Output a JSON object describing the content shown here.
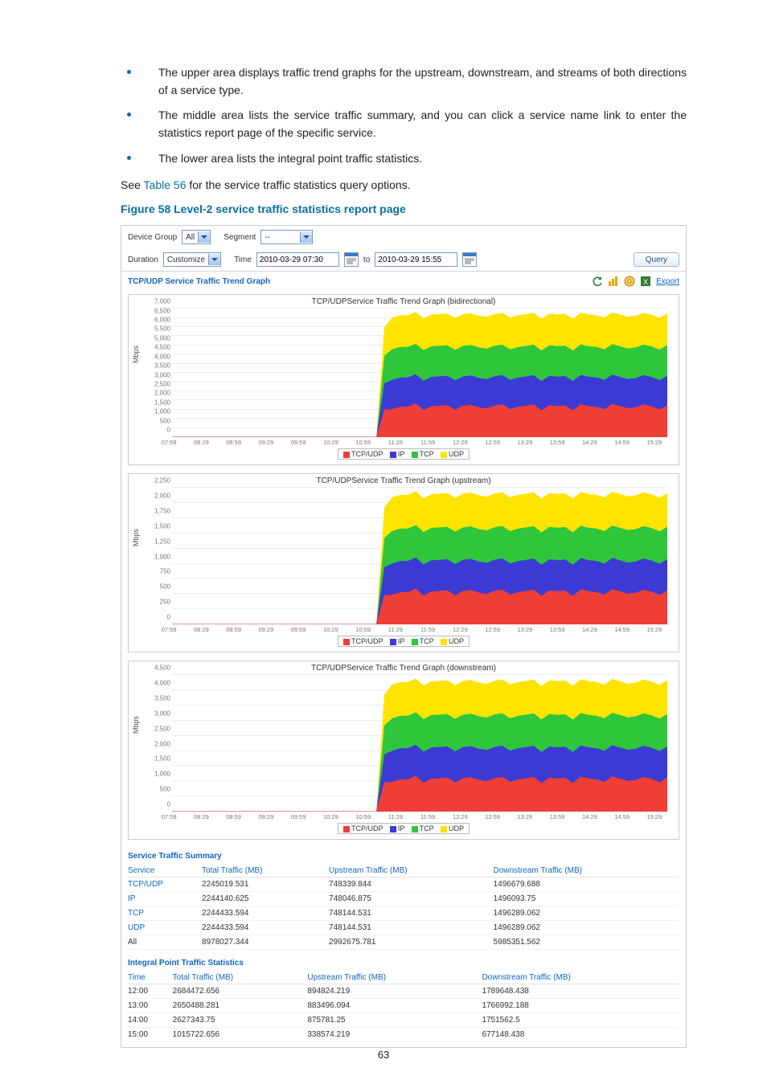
{
  "bullets": [
    "The upper area displays traffic trend graphs for the upstream, downstream, and streams of both directions of a service type.",
    "The middle area lists the service traffic summary, and you can click a service name link to enter the statistics report page of the specific service.",
    "The lower area lists the integral point traffic statistics."
  ],
  "see_before": "See ",
  "see_link": "Table 56",
  "see_after": " for the service traffic statistics query options.",
  "figure_caption": "Figure 58 Level-2 service traffic statistics report page",
  "page_number": "63",
  "form": {
    "device_group_label": "Device Group",
    "device_group_value": "All",
    "segment_label": "Segment",
    "segment_value": "--",
    "duration_label": "Duration",
    "duration_value": "Customize",
    "time_label": "Time",
    "start_value": "2010-03-29 07:30",
    "to_label": "to",
    "end_value": "2010-03-29 15:55",
    "query_label": "Query"
  },
  "panel_title": "TCP/UDP Service Traffic Trend Graph",
  "export_label": "Export",
  "chart_titles": {
    "bi": "TCP/UDPService Traffic Trend Graph (bidirectional)",
    "up": "TCP/UDPService Traffic Trend Graph (upstream)",
    "down": "TCP/UDPService Traffic Trend Graph (downstream)"
  },
  "xticks": [
    "07:59",
    "08:29",
    "08:59",
    "09:29",
    "09:59",
    "10:29",
    "10:59",
    "11:29",
    "11:59",
    "12:29",
    "12:59",
    "13:29",
    "13:59",
    "14:29",
    "14:59",
    "15:29"
  ],
  "yticks": {
    "bi": [
      "0",
      "500",
      "1,000",
      "1,500",
      "2,000",
      "2,500",
      "3,000",
      "3,500",
      "4,000",
      "4,500",
      "5,000",
      "5,500",
      "6,000",
      "6,500",
      "7,000"
    ],
    "up": [
      "0",
      "250",
      "500",
      "750",
      "1,000",
      "1,250",
      "1,500",
      "1,750",
      "2,000",
      "2,250"
    ],
    "down": [
      "0",
      "500",
      "1,000",
      "1,500",
      "2,000",
      "2,500",
      "3,000",
      "3,500",
      "4,000",
      "4,500"
    ]
  },
  "legend": [
    "TCP/UDP",
    "IP",
    "TCP",
    "UDP"
  ],
  "ylabel": "Mbps",
  "chart_data": [
    {
      "type": "area",
      "title": "TCP/UDPService Traffic Trend Graph (bidirectional)",
      "xlabel": "",
      "ylabel": "Mbps",
      "ylim": [
        0,
        7000
      ],
      "x": [
        "07:59",
        "08:29",
        "08:59",
        "09:29",
        "09:59",
        "10:29",
        "10:59",
        "11:29",
        "11:59",
        "12:29",
        "12:59",
        "13:29",
        "13:59",
        "14:29",
        "14:59",
        "15:29"
      ],
      "series": [
        {
          "name": "TCP/UDP",
          "values": [
            0,
            0,
            0,
            0,
            0,
            0,
            0,
            1600,
            1650,
            1500,
            1550,
            1700,
            1500,
            1550,
            1650,
            1500
          ]
        },
        {
          "name": "IP",
          "values": [
            0,
            0,
            0,
            0,
            0,
            0,
            0,
            1600,
            1650,
            1500,
            1550,
            1700,
            1500,
            1550,
            1650,
            1500
          ]
        },
        {
          "name": "TCP",
          "values": [
            0,
            0,
            0,
            0,
            0,
            0,
            0,
            1600,
            1650,
            1500,
            1550,
            1700,
            1500,
            1550,
            1650,
            1500
          ]
        },
        {
          "name": "UDP",
          "values": [
            0,
            0,
            0,
            0,
            0,
            0,
            0,
            1600,
            1650,
            1500,
            1550,
            1700,
            1500,
            1550,
            1650,
            1500
          ]
        }
      ],
      "note": "Series values are per-layer contributions; total (stacked) peaks around 6500–6800 Mbps during 11:29–15:29 and is ~0 before ~11:00."
    },
    {
      "type": "area",
      "title": "TCP/UDPService Traffic Trend Graph (upstream)",
      "xlabel": "",
      "ylabel": "Mbps",
      "ylim": [
        0,
        2250
      ],
      "x": [
        "07:59",
        "08:29",
        "08:59",
        "09:29",
        "09:59",
        "10:29",
        "10:59",
        "11:29",
        "11:59",
        "12:29",
        "12:59",
        "13:29",
        "13:59",
        "14:29",
        "14:59",
        "15:29"
      ],
      "series": [
        {
          "name": "TCP/UDP",
          "values": [
            0,
            0,
            0,
            0,
            0,
            0,
            0,
            530,
            550,
            500,
            520,
            560,
            500,
            520,
            550,
            500
          ]
        },
        {
          "name": "IP",
          "values": [
            0,
            0,
            0,
            0,
            0,
            0,
            0,
            530,
            550,
            500,
            520,
            560,
            500,
            520,
            550,
            500
          ]
        },
        {
          "name": "TCP",
          "values": [
            0,
            0,
            0,
            0,
            0,
            0,
            0,
            530,
            550,
            500,
            520,
            560,
            500,
            520,
            550,
            500
          ]
        },
        {
          "name": "UDP",
          "values": [
            0,
            0,
            0,
            0,
            0,
            0,
            0,
            530,
            550,
            500,
            520,
            560,
            500,
            520,
            550,
            500
          ]
        }
      ],
      "note": "Stacked total peaks around 2100–2200 Mbps during 11:29–15:29."
    },
    {
      "type": "area",
      "title": "TCP/UDPService Traffic Trend Graph (downstream)",
      "xlabel": "",
      "ylabel": "Mbps",
      "ylim": [
        0,
        4500
      ],
      "x": [
        "07:59",
        "08:29",
        "08:59",
        "09:29",
        "09:59",
        "10:29",
        "10:59",
        "11:29",
        "11:59",
        "12:29",
        "12:59",
        "13:29",
        "13:59",
        "14:29",
        "14:59",
        "15:29"
      ],
      "series": [
        {
          "name": "TCP/UDP",
          "values": [
            0,
            0,
            0,
            0,
            0,
            0,
            0,
            1070,
            1100,
            1000,
            1030,
            1140,
            1000,
            1030,
            1100,
            1000
          ]
        },
        {
          "name": "IP",
          "values": [
            0,
            0,
            0,
            0,
            0,
            0,
            0,
            1070,
            1100,
            1000,
            1030,
            1140,
            1000,
            1030,
            1100,
            1000
          ]
        },
        {
          "name": "TCP",
          "values": [
            0,
            0,
            0,
            0,
            0,
            0,
            0,
            1070,
            1100,
            1000,
            1030,
            1140,
            1000,
            1030,
            1100,
            1000
          ]
        },
        {
          "name": "UDP",
          "values": [
            0,
            0,
            0,
            0,
            0,
            0,
            0,
            1070,
            1100,
            1000,
            1030,
            1140,
            1000,
            1030,
            1100,
            1000
          ]
        }
      ],
      "note": "Stacked total peaks around 4300–4500 Mbps during 11:29–15:29."
    }
  ],
  "summary": {
    "title": "Service Traffic Summary",
    "cols": [
      "Service",
      "Total Traffic (MB)",
      "Upstream Traffic (MB)",
      "Downstream Traffic (MB)"
    ],
    "rows": [
      [
        "TCP/UDP",
        "2245019.531",
        "748339.844",
        "1496679.688"
      ],
      [
        "IP",
        "2244140.625",
        "748046.875",
        "1496093.75"
      ],
      [
        "TCP",
        "2244433.594",
        "748144.531",
        "1496289.062"
      ],
      [
        "UDP",
        "2244433.594",
        "748144.531",
        "1496289.062"
      ],
      [
        "All",
        "8978027.344",
        "2992675.781",
        "5985351.562"
      ]
    ]
  },
  "integral": {
    "title": "Integral Point Traffic Statistics",
    "cols": [
      "Time",
      "Total Traffic (MB)",
      "Upstream Traffic (MB)",
      "Downstream Traffic (MB)"
    ],
    "rows": [
      [
        "12:00",
        "2684472.656",
        "894824.219",
        "1789648.438"
      ],
      [
        "13:00",
        "2650488.281",
        "883496.094",
        "1766992.188"
      ],
      [
        "14:00",
        "2627343.75",
        "875781.25",
        "1751562.5"
      ],
      [
        "15:00",
        "1015722.656",
        "338574.219",
        "677148.438"
      ]
    ]
  }
}
